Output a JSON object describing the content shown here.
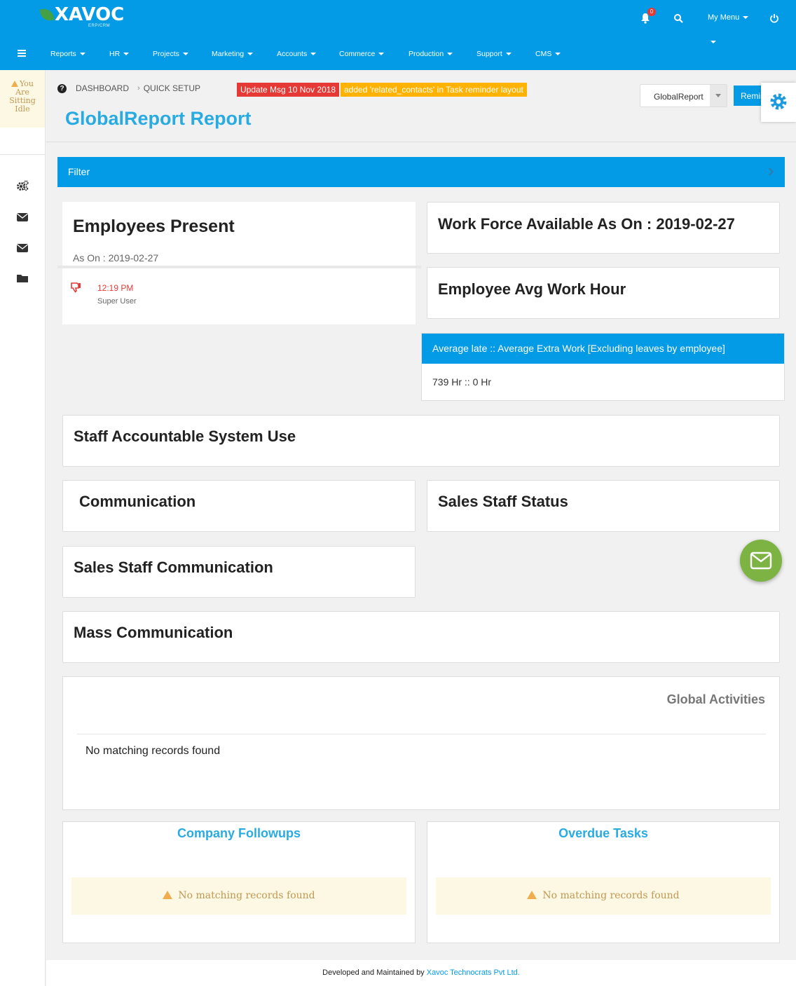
{
  "app": {
    "logo_text": "XAVOC",
    "logo_sub": "ERP/CRM"
  },
  "topbar": {
    "notification_count": "0",
    "my_menu_label": "My Menu"
  },
  "nav": {
    "items": [
      {
        "label": "Reports"
      },
      {
        "label": "HR"
      },
      {
        "label": "Projects"
      },
      {
        "label": "Marketing"
      },
      {
        "label": "Accounts"
      },
      {
        "label": "Commerce"
      },
      {
        "label": "Production"
      },
      {
        "label": "Support"
      },
      {
        "label": "CMS"
      }
    ]
  },
  "sidebar": {
    "idle_lines": [
      "You",
      "Are",
      "Sitting",
      "Idle"
    ],
    "icons": [
      "gears-icon",
      "envelope-icon",
      "envelope-icon",
      "folder-icon"
    ]
  },
  "breadcrumb": {
    "dashboard": "DASHBOARD",
    "quick_setup": "QUICK SETUP"
  },
  "update": {
    "label": "Update Msg 10 Nov 2018",
    "message": "added 'related_contacts' in Task reminder layout"
  },
  "page": {
    "title": "GlobalReport Report",
    "report_select_value": "GlobalReport",
    "remind_button": "Remind"
  },
  "filter": {
    "label": "Filter"
  },
  "employees_present": {
    "title": "Employees Present",
    "as_on": "As On : 2019-02-27",
    "entries": [
      {
        "time": "12:19 PM",
        "user": "Super User"
      }
    ]
  },
  "cards": {
    "work_force": "Work Force Available As On : 2019-02-27",
    "avg_work_hour": "Employee Avg Work Hour",
    "staff_accountable": "Staff Accountable System Use",
    "communication": "Communication",
    "sales_staff_status": "Sales Staff Status",
    "sales_staff_communication": "Sales Staff Communication",
    "mass_communication": "Mass Communication"
  },
  "average_late": {
    "header": "Average late :: Average Extra Work [Excluding leaves by employee]",
    "value": "739 Hr :: 0 Hr"
  },
  "global_activities": {
    "title": "Global Activities",
    "empty": "No matching records found"
  },
  "company_followups": {
    "title": "Company Followups",
    "empty": "No matching records found"
  },
  "overdue_tasks": {
    "title": "Overdue Tasks",
    "empty": "No matching records found"
  },
  "footer": {
    "text": "Developed and Maintained by",
    "link": "Xavoc Technocrats Pvt Ltd."
  },
  "colors": {
    "primary": "#039be5",
    "accent_title": "#29abe2",
    "alert_red": "#e53935",
    "alert_orange": "#ffb300",
    "warning_bg": "#fcf8e3",
    "mail_fab": "#7cb342"
  }
}
